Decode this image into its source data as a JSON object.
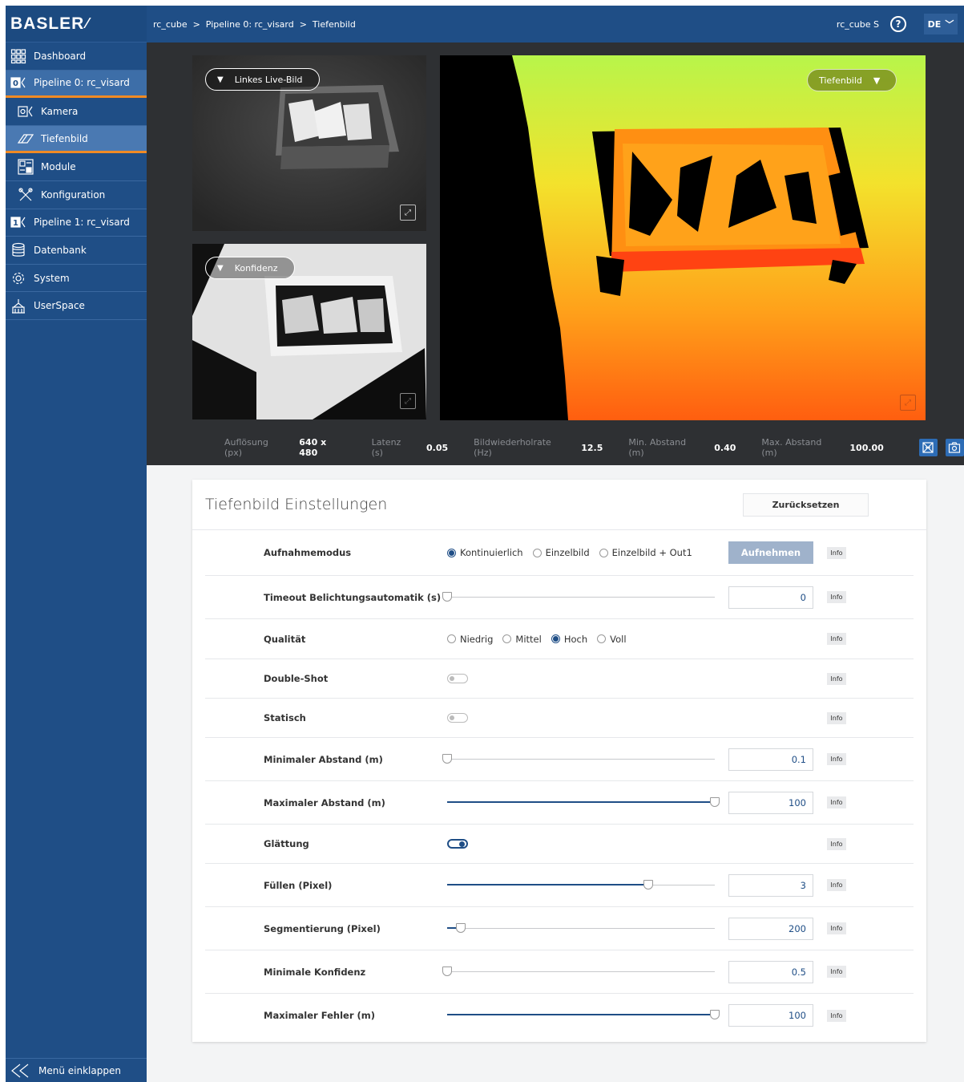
{
  "brand": "BASLER",
  "sidebar": {
    "items": [
      {
        "label": "Dashboard"
      },
      {
        "label": "Pipeline 0: rc_visard"
      },
      {
        "label": "Kamera"
      },
      {
        "label": "Tiefenbild"
      },
      {
        "label": "Module"
      },
      {
        "label": "Konfiguration"
      },
      {
        "label": "Pipeline 1: rc_visard"
      },
      {
        "label": "Datenbank"
      },
      {
        "label": "System"
      },
      {
        "label": "UserSpace"
      }
    ],
    "collapse_label": "Menü einklappen"
  },
  "topbar": {
    "breadcrumb": "rc_cube  >  Pipeline 0: rc_visard  >  Tiefenbild",
    "device": "rc_cube S",
    "help": "?",
    "lang": "DE"
  },
  "viewer": {
    "left_live_label": "Linkes Live-Bild",
    "confidence_label": "Konfidenz",
    "depth_label": "Tiefenbild",
    "stats": [
      {
        "label": "Auflösung (px)",
        "value": "640 x 480"
      },
      {
        "label": "Latenz (s)",
        "value": "0.05"
      },
      {
        "label": "Bildwiederholrate (Hz)",
        "value": "12.5"
      },
      {
        "label": "Min. Abstand (m)",
        "value": "0.40"
      },
      {
        "label": "Max. Abstand (m)",
        "value": "100.00"
      }
    ]
  },
  "settings": {
    "title": "Tiefenbild Einstellungen",
    "reset_label": "Zurücksetzen",
    "info_label": "Info",
    "capture_label": "Aufnehmen",
    "mode": {
      "label": "Aufnahmemodus",
      "options": [
        "Kontinuierlich",
        "Einzelbild",
        "Einzelbild + Out1"
      ],
      "selected": 0
    },
    "timeout": {
      "label": "Timeout Belichtungsautomatik (s)",
      "value": "0",
      "fraction": 0
    },
    "quality": {
      "label": "Qualität",
      "options": [
        "Niedrig",
        "Mittel",
        "Hoch",
        "Voll"
      ],
      "selected": 2
    },
    "double_shot": {
      "label": "Double-Shot",
      "on": false
    },
    "static": {
      "label": "Statisch",
      "on": false
    },
    "min_dist": {
      "label": "Minimaler Abstand (m)",
      "value": "0.1",
      "fraction": 0
    },
    "max_dist": {
      "label": "Maximaler Abstand (m)",
      "value": "100",
      "fraction": 1.0
    },
    "smoothing": {
      "label": "Glättung",
      "on": true
    },
    "fill": {
      "label": "Füllen (Pixel)",
      "value": "3",
      "fraction": 0.75
    },
    "segmentation": {
      "label": "Segmentierung (Pixel)",
      "value": "200",
      "fraction": 0.05
    },
    "min_conf": {
      "label": "Minimale Konfidenz",
      "value": "0.5",
      "fraction": 0
    },
    "max_err": {
      "label": "Maximaler Fehler (m)",
      "value": "100",
      "fraction": 1.0
    }
  }
}
